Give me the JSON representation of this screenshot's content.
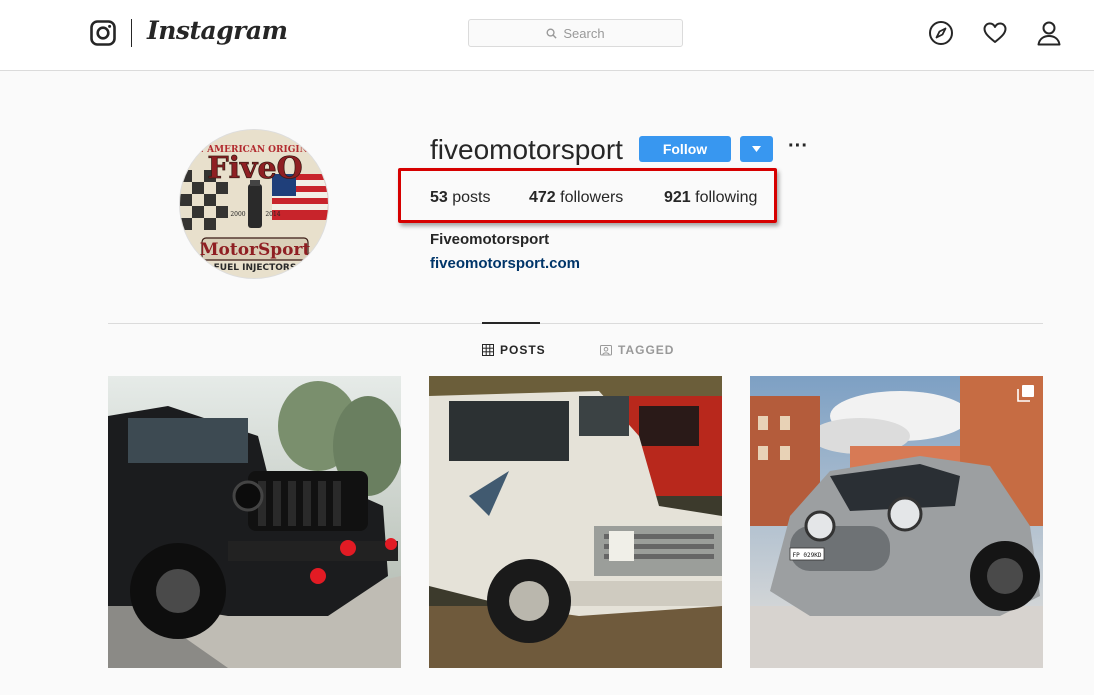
{
  "header": {
    "wordmark": "Instagram",
    "search_placeholder": "Search"
  },
  "profile": {
    "username": "fiveomotorsport",
    "follow_label": "Follow",
    "more_label": "···",
    "avatar_logo_text": [
      "AN AMERICAN ORIGINAL",
      "FiveO",
      "2000",
      "2014",
      "MotorSport",
      "FUEL INJECTORS"
    ],
    "stats": {
      "posts_count": "53",
      "posts_label": "posts",
      "followers_count": "472",
      "followers_label": "followers",
      "following_count": "921",
      "following_label": "following"
    },
    "full_name": "Fiveomotorsport",
    "website": "fiveomotorsport.com"
  },
  "tabs": [
    {
      "label": "POSTS",
      "icon": "grid-icon",
      "active": true
    },
    {
      "label": "TAGGED",
      "icon": "tag-icon",
      "active": false
    }
  ],
  "posts": [
    {
      "subject": "black jeep",
      "icon": null
    },
    {
      "subject": "white pickup truck",
      "icon": null
    },
    {
      "subject": "grey abarth car",
      "icon": "multiple-photos-icon",
      "plate": "FP 029KD"
    }
  ],
  "colors": {
    "accent": "#3897f0",
    "highlight": "#d60000",
    "link": "#003569"
  }
}
